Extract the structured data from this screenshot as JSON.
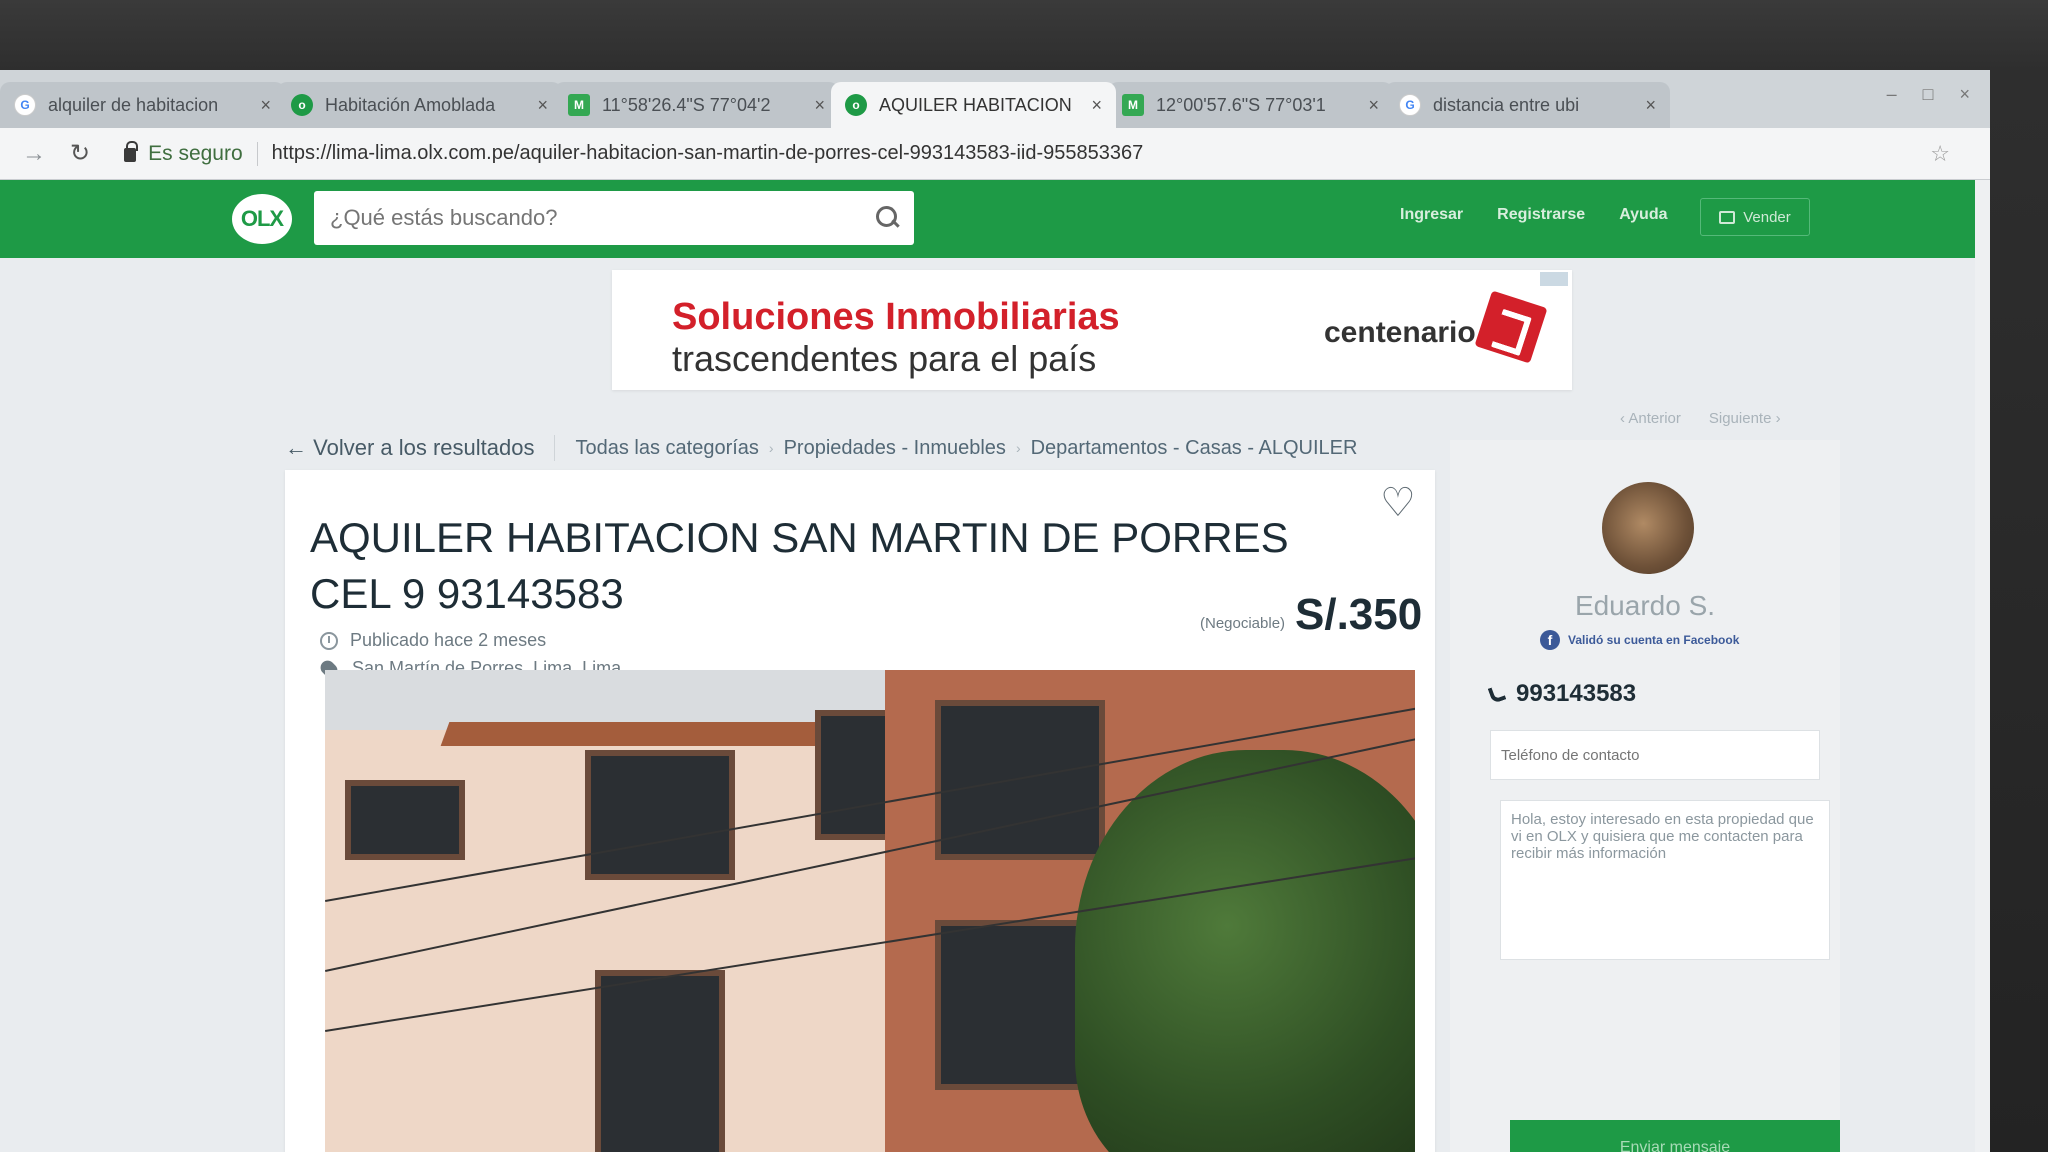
{
  "browser": {
    "tabs": [
      {
        "title": "alquiler de habitacion",
        "active": false,
        "favicon": "google-icon"
      },
      {
        "title": "Habitación Amoblada",
        "active": false,
        "favicon": "olx-icon"
      },
      {
        "title": "11°58'26.4\"S 77°04'2",
        "active": false,
        "favicon": "maps-icon"
      },
      {
        "title": "AQUILER HABITACION",
        "active": true,
        "favicon": "olx-icon"
      },
      {
        "title": "12°00'57.6\"S 77°03'1",
        "active": false,
        "favicon": "maps-icon"
      },
      {
        "title": "distancia entre ubi",
        "active": false,
        "favicon": "google-icon"
      }
    ],
    "secure_label": "Es seguro",
    "url": "https://lima-lima.olx.com.pe/aquiler-habitacion-san-martin-de-porres-cel-993143583-iid-955853367"
  },
  "header": {
    "logo_text": "OLX",
    "search_placeholder": "¿Qué estás buscando?",
    "links": [
      "Ingresar",
      "Registrarse",
      "Ayuda"
    ],
    "sell_label": "Vender"
  },
  "banner": {
    "line1": "Soluciones Inmobiliarias",
    "line2": "trascendentes para el país",
    "brand": "centenario"
  },
  "breadcrumbs": {
    "back_label": "Volver a los resultados",
    "items": [
      "Todas las categorías",
      "Propiedades - Inmuebles",
      "Departamentos - Casas - ALQUILER"
    ],
    "prev_label": "Anterior",
    "next_label": "Siguiente"
  },
  "listing": {
    "title": "AQUILER HABITACION SAN MARTIN DE PORRES CEL 9 93143583",
    "negotiable": "(Negociable)",
    "price": "S/.350",
    "published": "Publicado hace 2 meses",
    "location": "San Martín de Porres, Lima, Lima"
  },
  "seller": {
    "name": "Eduardo S.",
    "verified_text": "Validó su cuenta en Facebook",
    "phone": "993143583",
    "contact_phone_placeholder": "Teléfono de contacto",
    "message": "Hola, estoy interesado en esta propiedad que vi en OLX y quisiera que me contacten para recibir más información",
    "send_label": "Enviar mensaje"
  },
  "colors": {
    "olx_green": "#1e9a46",
    "ad_red": "#d3202a"
  }
}
